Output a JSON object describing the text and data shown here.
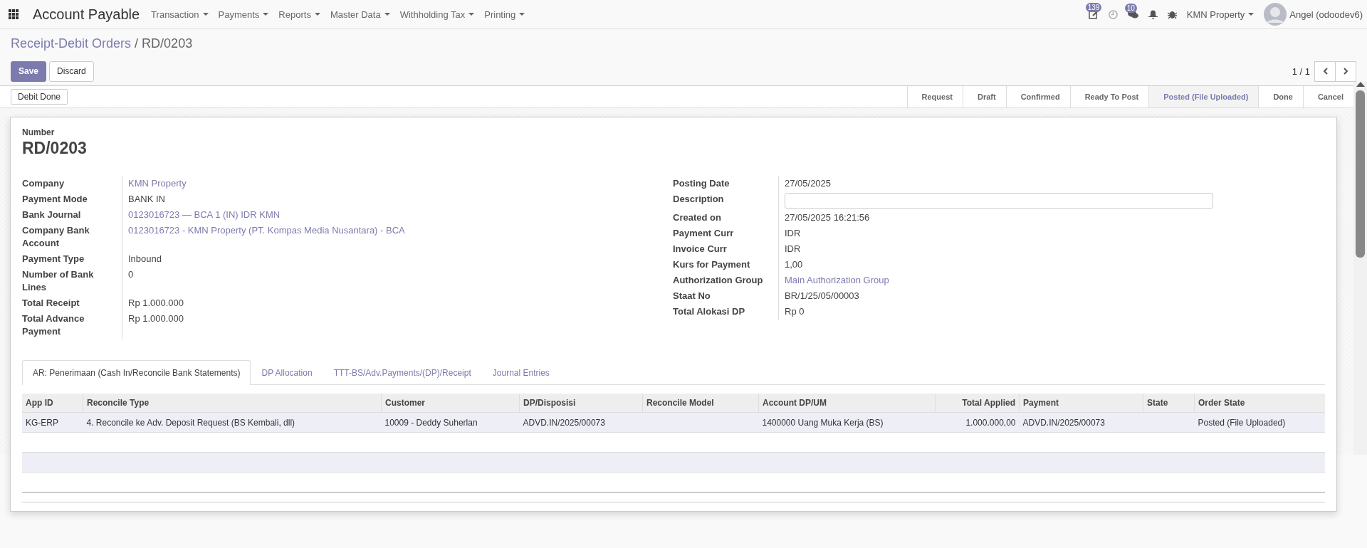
{
  "navbar": {
    "app_title": "Account Payable",
    "menus": [
      "Transaction",
      "Payments",
      "Reports",
      "Master Data",
      "Withholding Tax",
      "Printing"
    ],
    "activity_badge": "139",
    "messages_badge": "10",
    "company": "KMN Property",
    "user": "Angel (odoodev6)"
  },
  "breadcrumb": {
    "parent": "Receipt-Debit Orders",
    "separator": "/",
    "current": "RD/0203"
  },
  "buttons": [
    {
      "label": "Save",
      "kind": "primary"
    },
    {
      "label": "Discard",
      "kind": "secondary"
    }
  ],
  "pager": "1 / 1",
  "header_buttons": [
    "Debit Done"
  ],
  "stages": [
    {
      "label": "Request",
      "selected": false
    },
    {
      "label": "Draft",
      "selected": false
    },
    {
      "label": "Confirmed",
      "selected": false
    },
    {
      "label": "Ready To Post",
      "selected": false
    },
    {
      "label": "Posted (File Uploaded)",
      "selected": true
    },
    {
      "label": "Done",
      "selected": false
    },
    {
      "label": "Cancel",
      "selected": false
    }
  ],
  "form": {
    "number_label": "Number",
    "number": "RD/0203",
    "left_fields": [
      {
        "label": "Company",
        "value": "KMN Property",
        "kind": "link"
      },
      {
        "label": "Payment Mode",
        "value": "BANK IN",
        "kind": "text"
      },
      {
        "label": "Bank Journal",
        "value": "0123016723 — BCA 1 (IN) IDR KMN",
        "kind": "link"
      },
      {
        "label": "Company Bank Account",
        "value": "0123016723 - KMN Property (PT. Kompas Media Nusantara) - BCA",
        "kind": "link"
      },
      {
        "label": "Payment Type",
        "value": "Inbound",
        "kind": "text"
      },
      {
        "label": "Number of Bank Lines",
        "value": "0",
        "kind": "text"
      },
      {
        "label": "Total Receipt",
        "value": "Rp 1.000.000",
        "kind": "text"
      },
      {
        "label": "Total Advance Payment",
        "value": "Rp 1.000.000",
        "kind": "text"
      }
    ],
    "right_fields": [
      {
        "label": "Posting Date",
        "value": "27/05/2025",
        "kind": "text"
      },
      {
        "label": "Description",
        "kind": "input"
      },
      {
        "label": "Created on",
        "value": "27/05/2025 16:21:56",
        "kind": "text"
      },
      {
        "label": "Payment Curr",
        "value": "IDR",
        "kind": "text"
      },
      {
        "label": "Invoice Curr",
        "value": "IDR",
        "kind": "text"
      },
      {
        "label": "Kurs for Payment",
        "value": "1,00",
        "kind": "text"
      },
      {
        "label": "Authorization Group",
        "value": "Main Authorization Group",
        "kind": "link"
      },
      {
        "label": "Staat No",
        "value": "BR/1/25/05/00003",
        "kind": "text"
      },
      {
        "label": "Total Alokasi DP",
        "value": "Rp 0",
        "kind": "text"
      }
    ]
  },
  "tabs": [
    {
      "label": "AR: Penerimaan (Cash In/Reconcile Bank Statements)",
      "selected": true
    },
    {
      "label": "DP Allocation",
      "selected": false
    },
    {
      "label": "TTT-BS/Adv.Payments/(DP)/Receipt",
      "selected": false
    },
    {
      "label": "Journal Entries",
      "selected": false
    }
  ],
  "table": {
    "columns": [
      {
        "label": "App ID",
        "kind": "text"
      },
      {
        "label": "Reconcile Type",
        "kind": "text"
      },
      {
        "label": "Customer",
        "kind": "text"
      },
      {
        "label": "DP/Disposisi",
        "kind": "text"
      },
      {
        "label": "Reconcile Model",
        "kind": "text"
      },
      {
        "label": "Account DP/UM",
        "kind": "text"
      },
      {
        "label": "Total Applied",
        "kind": "number"
      },
      {
        "label": "Payment",
        "kind": "text"
      },
      {
        "label": "State",
        "kind": "text"
      },
      {
        "label": "Order State",
        "kind": "text"
      }
    ],
    "rows": [
      [
        "KG-ERP",
        "4. Reconcile ke Adv. Deposit Request (BS Kembali, dll)",
        "10009 - Deddy Suherlan",
        "ADVD.IN/2025/00073",
        "",
        "1400000 Uang Muka Kerja (BS)",
        "1.000.000,00",
        "ADVD.IN/2025/00073",
        "",
        "Posted (File Uploaded)"
      ]
    ]
  }
}
